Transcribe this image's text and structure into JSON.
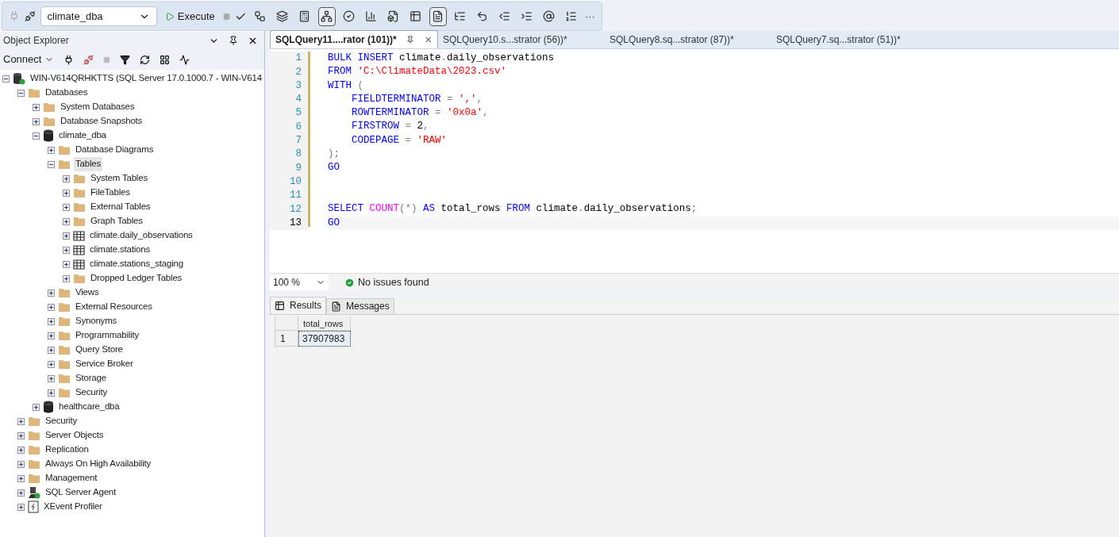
{
  "toolbar": {
    "database": "climate_dba",
    "execute": "Execute",
    "toggles": [
      {
        "pressed": false
      },
      {
        "pressed": false
      },
      {
        "pressed": false
      },
      {
        "pressed": true
      },
      {
        "pressed": false
      },
      {
        "pressed": false
      },
      {
        "pressed": false
      },
      {
        "pressed": false
      },
      {
        "pressed": true
      },
      {
        "pressed": false
      },
      {
        "pressed": false
      },
      {
        "pressed": false
      },
      {
        "pressed": false
      },
      {
        "pressed": false
      },
      {
        "pressed": false
      }
    ],
    "more": "···"
  },
  "object_explorer": {
    "title": "Object Explorer",
    "connect": "Connect",
    "tree": [
      {
        "label": "WIN-V614QRHKTTS (SQL Server 17.0.1000.7 - WIN-V614",
        "kind": "server",
        "expanded": true,
        "selected": false,
        "children": [
          {
            "label": "Databases",
            "kind": "folder",
            "expanded": true,
            "selected": false,
            "children": [
              {
                "label": "System Databases",
                "kind": "folder",
                "expanded": false,
                "selected": false
              },
              {
                "label": "Database Snapshots",
                "kind": "folder",
                "expanded": false,
                "selected": false
              },
              {
                "label": "climate_dba",
                "kind": "database",
                "expanded": true,
                "selected": false,
                "children": [
                  {
                    "label": "Database Diagrams",
                    "kind": "folder",
                    "expanded": false,
                    "selected": false
                  },
                  {
                    "label": "Tables",
                    "kind": "folder",
                    "expanded": true,
                    "selected": true,
                    "children": [
                      {
                        "label": "System Tables",
                        "kind": "folder",
                        "expanded": false,
                        "selected": false
                      },
                      {
                        "label": "FileTables",
                        "kind": "folder",
                        "expanded": false,
                        "selected": false
                      },
                      {
                        "label": "External Tables",
                        "kind": "folder",
                        "expanded": false,
                        "selected": false
                      },
                      {
                        "label": "Graph Tables",
                        "kind": "folder",
                        "expanded": false,
                        "selected": false
                      },
                      {
                        "label": "climate.daily_observations",
                        "kind": "table",
                        "expanded": false,
                        "selected": false
                      },
                      {
                        "label": "climate.stations",
                        "kind": "table",
                        "expanded": false,
                        "selected": false
                      },
                      {
                        "label": "climate.stations_staging",
                        "kind": "table",
                        "expanded": false,
                        "selected": false
                      },
                      {
                        "label": "Dropped Ledger Tables",
                        "kind": "folder",
                        "expanded": false,
                        "selected": false
                      }
                    ]
                  },
                  {
                    "label": "Views",
                    "kind": "folder",
                    "expanded": false,
                    "selected": false
                  },
                  {
                    "label": "External Resources",
                    "kind": "folder",
                    "expanded": false,
                    "selected": false
                  },
                  {
                    "label": "Synonyms",
                    "kind": "folder",
                    "expanded": false,
                    "selected": false
                  },
                  {
                    "label": "Programmability",
                    "kind": "folder",
                    "expanded": false,
                    "selected": false
                  },
                  {
                    "label": "Query Store",
                    "kind": "folder",
                    "expanded": false,
                    "selected": false
                  },
                  {
                    "label": "Service Broker",
                    "kind": "folder",
                    "expanded": false,
                    "selected": false
                  },
                  {
                    "label": "Storage",
                    "kind": "folder",
                    "expanded": false,
                    "selected": false
                  },
                  {
                    "label": "Security",
                    "kind": "folder",
                    "expanded": false,
                    "selected": false
                  }
                ]
              },
              {
                "label": "healthcare_dba",
                "kind": "database",
                "expanded": false,
                "selected": false
              }
            ]
          },
          {
            "label": "Security",
            "kind": "folder",
            "expanded": false,
            "selected": false
          },
          {
            "label": "Server Objects",
            "kind": "folder",
            "expanded": false,
            "selected": false
          },
          {
            "label": "Replication",
            "kind": "folder",
            "expanded": false,
            "selected": false
          },
          {
            "label": "Always On High Availability",
            "kind": "folder",
            "expanded": false,
            "selected": false
          },
          {
            "label": "Management",
            "kind": "folder",
            "expanded": false,
            "selected": false
          },
          {
            "label": "SQL Server Agent",
            "kind": "agent",
            "expanded": false,
            "selected": false
          },
          {
            "label": "XEvent Profiler",
            "kind": "profiler",
            "expanded": false,
            "selected": false
          }
        ]
      }
    ]
  },
  "editor_tabs": [
    {
      "label": "SQLQuery11....rator (101))*",
      "selected": true
    },
    {
      "label": "SQLQuery10.s...strator (56))*",
      "selected": false
    },
    {
      "label": "SQLQuery8.sq...strator (87))*",
      "selected": false
    },
    {
      "label": "SQLQuery7.sq...strator (51))*",
      "selected": false
    }
  ],
  "code": [
    {
      "number": "1",
      "current": false,
      "tokens": [
        {
          "kind": "keyword",
          "text": "BULK INSERT "
        },
        {
          "kind": "plain",
          "text": "climate"
        },
        {
          "kind": "punct",
          "text": "."
        },
        {
          "kind": "plain",
          "text": "daily_observations"
        }
      ]
    },
    {
      "number": "2",
      "current": false,
      "tokens": [
        {
          "kind": "keyword",
          "text": "FROM "
        },
        {
          "kind": "string",
          "text": "'C:\\ClimateData\\2023.csv'"
        }
      ]
    },
    {
      "number": "3",
      "current": false,
      "tokens": [
        {
          "kind": "keyword",
          "text": "WITH "
        },
        {
          "kind": "punct",
          "text": "("
        }
      ]
    },
    {
      "number": "4",
      "current": false,
      "indent": true,
      "tokens": [
        {
          "kind": "keyword",
          "text": "FIELDTERMINATOR "
        },
        {
          "kind": "punct",
          "text": "= "
        },
        {
          "kind": "string",
          "text": "','"
        },
        {
          "kind": "punct",
          "text": ","
        }
      ]
    },
    {
      "number": "5",
      "current": false,
      "indent": true,
      "tokens": [
        {
          "kind": "keyword",
          "text": "ROWTERMINATOR "
        },
        {
          "kind": "punct",
          "text": "= "
        },
        {
          "kind": "string",
          "text": "'0x0a'"
        },
        {
          "kind": "punct",
          "text": ","
        }
      ]
    },
    {
      "number": "6",
      "current": false,
      "indent": true,
      "tokens": [
        {
          "kind": "keyword",
          "text": "FIRSTROW "
        },
        {
          "kind": "punct",
          "text": "= "
        },
        {
          "kind": "plain",
          "text": "2"
        },
        {
          "kind": "punct",
          "text": ","
        }
      ]
    },
    {
      "number": "7",
      "current": false,
      "indent": true,
      "tokens": [
        {
          "kind": "keyword",
          "text": "CODEPAGE "
        },
        {
          "kind": "punct",
          "text": "= "
        },
        {
          "kind": "string",
          "text": "'RAW'"
        }
      ]
    },
    {
      "number": "8",
      "current": false,
      "tokens": [
        {
          "kind": "punct",
          "text": ");"
        }
      ]
    },
    {
      "number": "9",
      "current": false,
      "tokens": [
        {
          "kind": "keyword",
          "text": "GO"
        }
      ]
    },
    {
      "number": "10",
      "current": false
    },
    {
      "number": "11",
      "current": false
    },
    {
      "number": "12",
      "current": false,
      "tokens": [
        {
          "kind": "keyword",
          "text": "SELECT "
        },
        {
          "kind": "function",
          "text": "COUNT"
        },
        {
          "kind": "punct",
          "text": "(*) "
        },
        {
          "kind": "keyword",
          "text": "AS "
        },
        {
          "kind": "plain",
          "text": "total_rows "
        },
        {
          "kind": "keyword",
          "text": "FROM "
        },
        {
          "kind": "plain",
          "text": "climate"
        },
        {
          "kind": "punct",
          "text": "."
        },
        {
          "kind": "plain",
          "text": "daily_observations"
        },
        {
          "kind": "punct",
          "text": ";"
        }
      ]
    },
    {
      "number": "13",
      "current": true,
      "tokens": [
        {
          "kind": "keyword",
          "text": "GO"
        }
      ]
    }
  ],
  "status": {
    "zoom": "100 %",
    "issues": "No issues found"
  },
  "result_tabs": [
    {
      "label": "Results",
      "selected": true
    },
    {
      "label": "Messages",
      "selected": false
    }
  ],
  "results": {
    "columns": [
      "total_rows"
    ],
    "rows": [
      {
        "number": "1",
        "cells": [
          "37907983"
        ]
      }
    ]
  }
}
